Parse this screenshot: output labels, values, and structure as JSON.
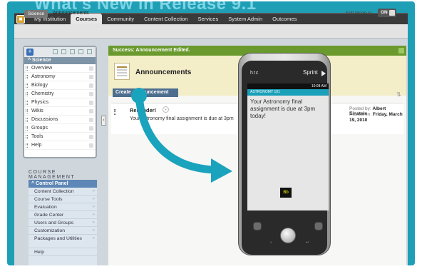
{
  "header": {
    "title": "What's New in Release 9.1"
  },
  "tabs": [
    "My Institution",
    "Courses",
    "Community",
    "Content Collection",
    "Services",
    "System Admin",
    "Outcomes"
  ],
  "active_tab": "Courses",
  "breadcrumb": {
    "course": "Science",
    "page": "Announcements"
  },
  "edit_mode": {
    "label": "Edit Mode is:",
    "value": "ON"
  },
  "course_menu": {
    "title": "Science",
    "items": [
      "Overview",
      "Astronomy",
      "Biology",
      "Chemistry",
      "Physics",
      "Wikis",
      "Discussions",
      "Groups",
      "Tools",
      "Help"
    ]
  },
  "course_management": {
    "title": "COURSE MANAGEMENT",
    "panel_title": "Control Panel",
    "items": [
      "Content Collection",
      "Course Tools",
      "Evaluation",
      "Grade Center",
      "Users and Groups",
      "Customization",
      "Packages and Utilities",
      "Help"
    ]
  },
  "success_message": "Success: Announcement Edited.",
  "page_title": "Announcements",
  "create_button": "Create Announcement",
  "announcement": {
    "title": "Reminder!",
    "body": "Your Astronomy final assignment is due at 3pm",
    "posted_by_label": "Posted by:",
    "posted_by": "Albert Einstein",
    "posted_on_label": "Posted on:",
    "posted_on": "Friday, March 19, 2010"
  },
  "phone": {
    "brand": "htc",
    "carrier": "Sprint",
    "time": "10:08 AM",
    "course_label": "ASTRONOMY 101",
    "message": "Your Astronomy final assignment is due at 3pm today!"
  },
  "colors": {
    "frame": "#1e9fb5",
    "arrow": "#1aa3bd",
    "success": "#6a9a2e"
  }
}
